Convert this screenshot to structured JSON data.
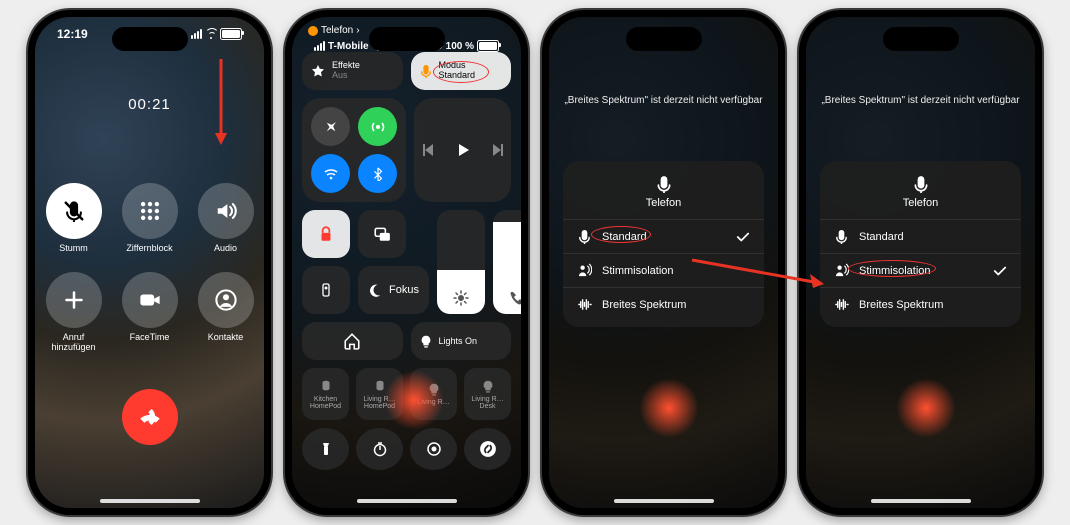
{
  "phone1": {
    "clock": "12:19",
    "timer": "00:21",
    "buttons": {
      "mute": "Stumm",
      "keypad": "Ziffernblock",
      "audio": "Audio",
      "add": "Anruf hinzufügen",
      "facetime": "FaceTime",
      "contacts": "Kontakte"
    }
  },
  "phone2": {
    "app_name": "Telefon",
    "carrier": "T-Mobile",
    "battery": "100 %",
    "effects_label": "Effekte",
    "effects_state": "Aus",
    "mode_label": "Modus",
    "mode_value": "Standard",
    "focus": "Fokus",
    "lights": "Lights On",
    "devices": {
      "d1": "Kitchen HomePod",
      "d2": "Living R… HomePod",
      "d3": "Living R…",
      "d4": "Living R… Desk"
    }
  },
  "mic": {
    "notice": "„Breites Spektrum\" ist derzeit nicht verfügbar",
    "title": "Telefon",
    "opt_standard": "Standard",
    "opt_isolation": "Stimmisolation",
    "opt_wide": "Breites Spektrum"
  }
}
